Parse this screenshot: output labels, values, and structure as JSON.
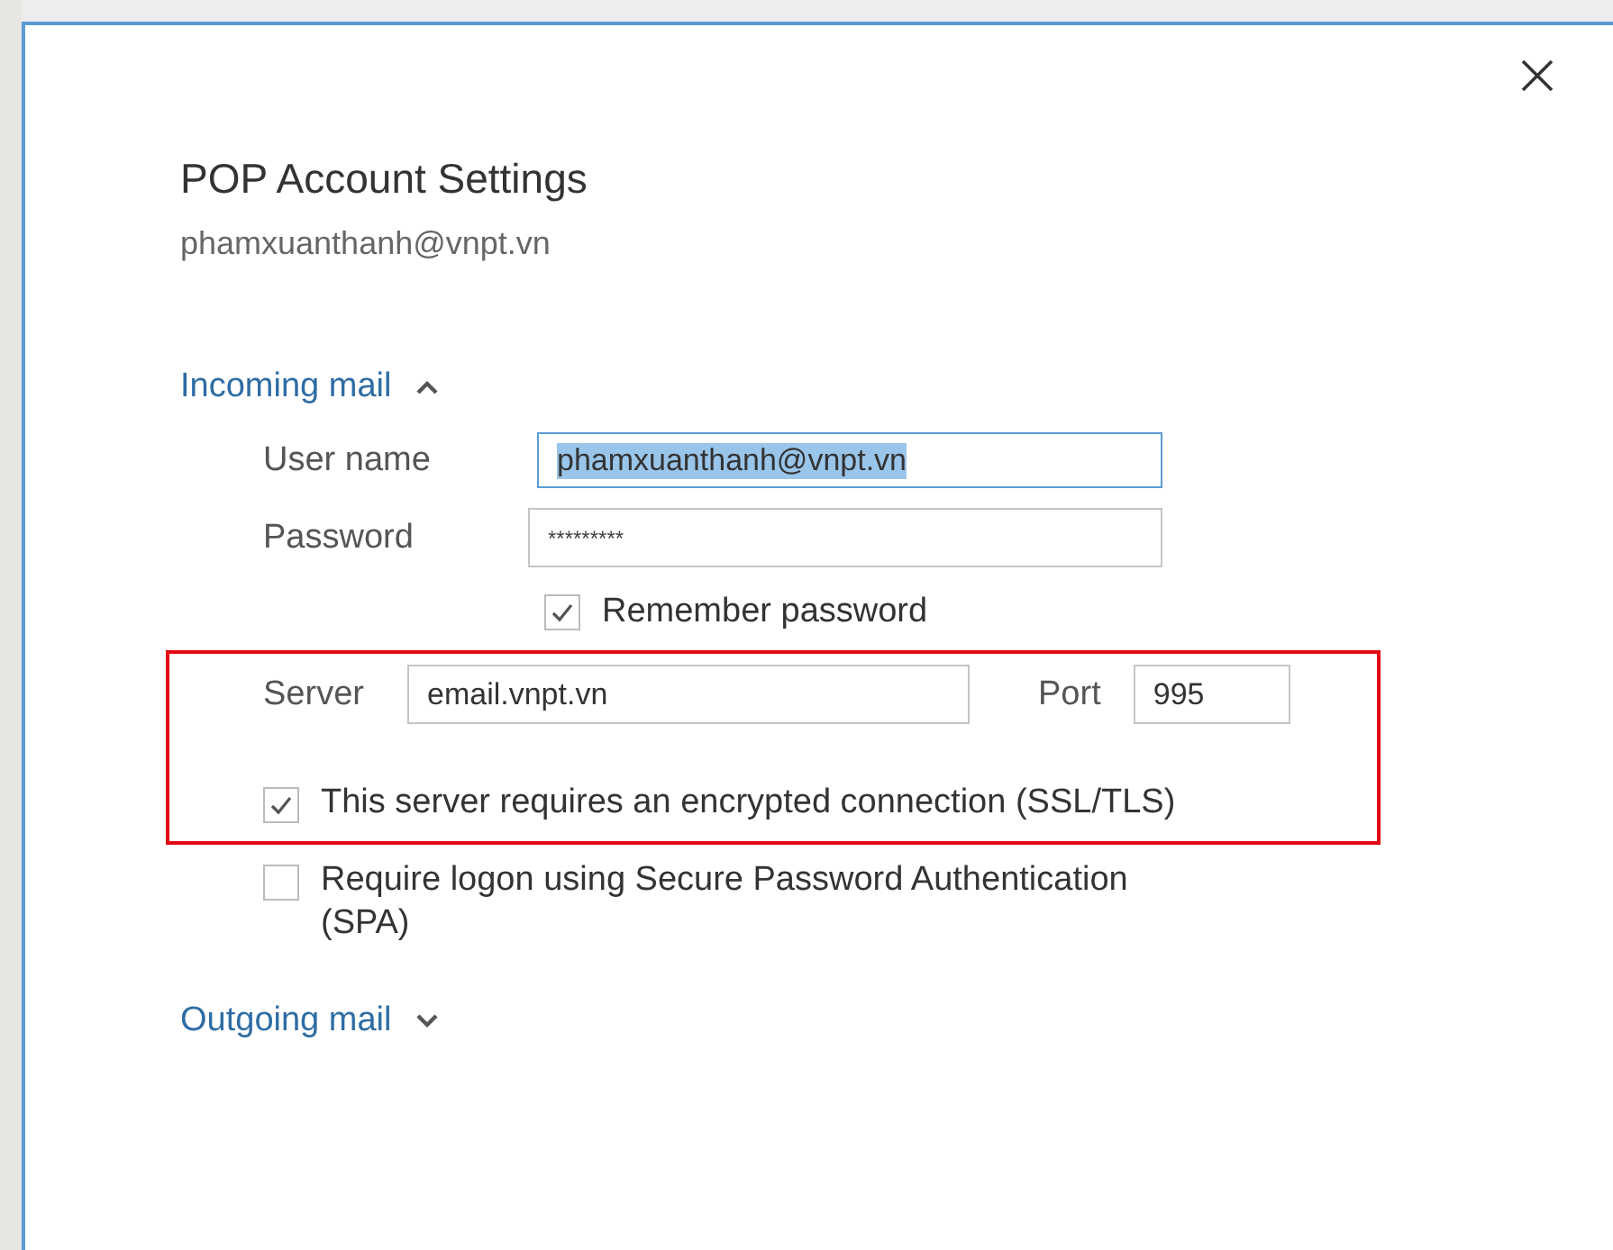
{
  "dialog": {
    "title": "POP Account Settings",
    "account": "phamxuanthanh@vnpt.vn"
  },
  "incoming": {
    "label": "Incoming mail",
    "expanded": true
  },
  "user_name": {
    "label": "User name",
    "value": "phamxuanthanh@vnpt.vn",
    "focused": true
  },
  "password": {
    "label": "Password",
    "value": "*********"
  },
  "remember": {
    "label": "Remember password",
    "checked": true
  },
  "server_section": {
    "highlighted": true,
    "server": {
      "label": "Server",
      "value": "email.vnpt.vn"
    },
    "port": {
      "label": "Port",
      "value": "995"
    },
    "encryption": {
      "label": "This server requires an encrypted connection (SSL/TLS)",
      "checked": true
    }
  },
  "spa": {
    "label": "Require logon using Secure Password Authentication (SPA)",
    "checked": false
  },
  "outgoing": {
    "label": "Outgoing mail",
    "expanded": false
  }
}
